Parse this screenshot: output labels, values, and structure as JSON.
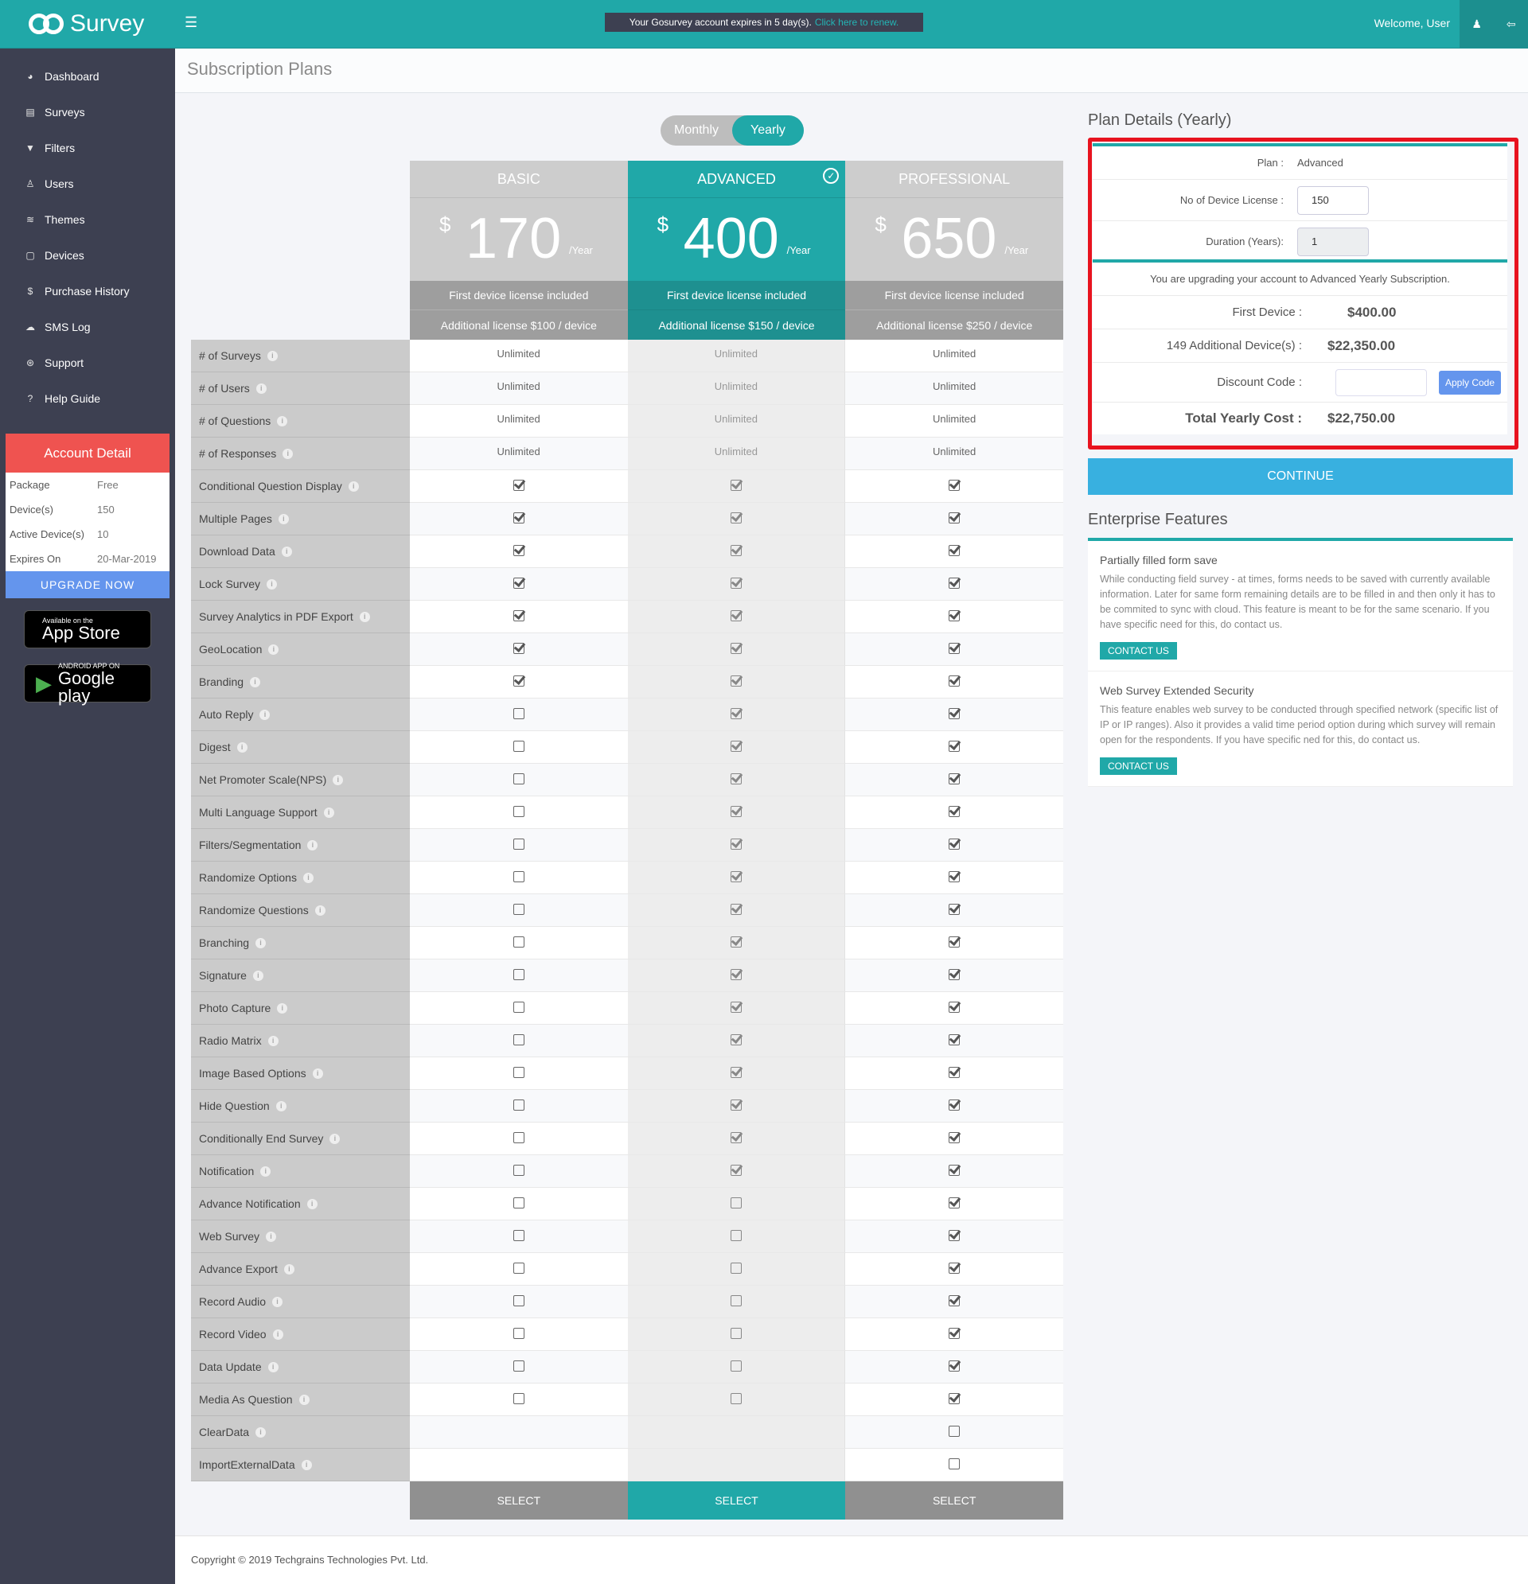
{
  "app": {
    "name": "Survey",
    "logo": "GO"
  },
  "header": {
    "notice_text": "Your Gosurvey account expires in 5 day(s).",
    "notice_link": "Click here to renew.",
    "welcome": "Welcome, User",
    "icons": [
      "menu-icon",
      "user-icon",
      "logout-icon"
    ]
  },
  "sidebar": {
    "items": [
      {
        "label": "Dashboard",
        "icon": "dashboard-icon",
        "glyph": "◕"
      },
      {
        "label": "Surveys",
        "icon": "surveys-icon",
        "glyph": "▤"
      },
      {
        "label": "Filters",
        "icon": "filter-icon",
        "glyph": "▼"
      },
      {
        "label": "Users",
        "icon": "user-icon",
        "glyph": "♙"
      },
      {
        "label": "Themes",
        "icon": "layers-icon",
        "glyph": "≋"
      },
      {
        "label": "Devices",
        "icon": "device-icon",
        "glyph": "▢"
      },
      {
        "label": "Purchase History",
        "icon": "dollar-icon",
        "glyph": "$"
      },
      {
        "label": "SMS Log",
        "icon": "chat-icon",
        "glyph": "☁"
      },
      {
        "label": "Support",
        "icon": "support-icon",
        "glyph": "⊛"
      },
      {
        "label": "Help Guide",
        "icon": "question-icon",
        "glyph": "?"
      }
    ],
    "account": {
      "title": "Account Detail",
      "rows": [
        {
          "k": "Package",
          "v": "Free"
        },
        {
          "k": "Device(s)",
          "v": "150"
        },
        {
          "k": "Active Device(s)",
          "v": "10"
        },
        {
          "k": "Expires On",
          "v": "20-Mar-2019"
        }
      ],
      "upgrade": "UPGRADE NOW"
    },
    "appstore": {
      "small": "Available on the",
      "big": "App Store"
    },
    "googleplay": {
      "small": "ANDROID APP ON",
      "big": "Google play"
    }
  },
  "page": {
    "title": "Subscription Plans"
  },
  "billing_toggle": {
    "options": [
      "Monthly",
      "Yearly"
    ],
    "selected": "Yearly"
  },
  "plans": [
    {
      "name": "BASIC",
      "currency": "$",
      "price": "170",
      "period": "/Year",
      "first": "First device license included",
      "additional": "Additional license $100 / device",
      "select": "SELECT",
      "selected": false
    },
    {
      "name": "ADVANCED",
      "currency": "$",
      "price": "400",
      "period": "/Year",
      "first": "First device license included",
      "additional": "Additional license $150 / device",
      "select": "SELECT",
      "selected": true
    },
    {
      "name": "PROFESSIONAL",
      "currency": "$",
      "price": "650",
      "period": "/Year",
      "first": "First device license included",
      "additional": "Additional license $250 / device",
      "select": "SELECT",
      "selected": false
    }
  ],
  "features": [
    {
      "label": "# of Surveys",
      "values": [
        "Unlimited",
        "Unlimited",
        "Unlimited"
      ]
    },
    {
      "label": "# of Users",
      "values": [
        "Unlimited",
        "Unlimited",
        "Unlimited"
      ]
    },
    {
      "label": "# of Questions",
      "values": [
        "Unlimited",
        "Unlimited",
        "Unlimited"
      ]
    },
    {
      "label": "# of Responses",
      "values": [
        "Unlimited",
        "Unlimited",
        "Unlimited"
      ]
    },
    {
      "label": "Conditional Question Display",
      "values": [
        true,
        true,
        true
      ]
    },
    {
      "label": "Multiple Pages",
      "values": [
        true,
        true,
        true
      ]
    },
    {
      "label": "Download Data",
      "values": [
        true,
        true,
        true
      ]
    },
    {
      "label": "Lock Survey",
      "values": [
        true,
        true,
        true
      ]
    },
    {
      "label": "Survey Analytics in PDF Export",
      "values": [
        true,
        true,
        true
      ]
    },
    {
      "label": "GeoLocation",
      "values": [
        true,
        true,
        true
      ]
    },
    {
      "label": "Branding",
      "values": [
        true,
        true,
        true
      ]
    },
    {
      "label": "Auto Reply",
      "values": [
        false,
        true,
        true
      ]
    },
    {
      "label": "Digest",
      "values": [
        false,
        true,
        true
      ]
    },
    {
      "label": "Net Promoter Scale(NPS)",
      "values": [
        false,
        true,
        true
      ]
    },
    {
      "label": "Multi Language Support",
      "values": [
        false,
        true,
        true
      ]
    },
    {
      "label": "Filters/Segmentation",
      "values": [
        false,
        true,
        true
      ]
    },
    {
      "label": "Randomize Options",
      "values": [
        false,
        true,
        true
      ]
    },
    {
      "label": "Randomize Questions",
      "values": [
        false,
        true,
        true
      ]
    },
    {
      "label": "Branching",
      "values": [
        false,
        true,
        true
      ]
    },
    {
      "label": "Signature",
      "values": [
        false,
        true,
        true
      ]
    },
    {
      "label": "Photo Capture",
      "values": [
        false,
        true,
        true
      ]
    },
    {
      "label": "Radio Matrix",
      "values": [
        false,
        true,
        true
      ]
    },
    {
      "label": "Image Based Options",
      "values": [
        false,
        true,
        true
      ]
    },
    {
      "label": "Hide Question",
      "values": [
        false,
        true,
        true
      ]
    },
    {
      "label": "Conditionally End Survey",
      "values": [
        false,
        true,
        true
      ]
    },
    {
      "label": "Notification",
      "values": [
        false,
        true,
        true
      ]
    },
    {
      "label": "Advance Notification",
      "values": [
        false,
        false,
        true
      ]
    },
    {
      "label": "Web Survey",
      "values": [
        false,
        false,
        true
      ]
    },
    {
      "label": "Advance Export",
      "values": [
        false,
        false,
        true
      ]
    },
    {
      "label": "Record Audio",
      "values": [
        false,
        false,
        true
      ]
    },
    {
      "label": "Record Video",
      "values": [
        false,
        false,
        true
      ]
    },
    {
      "label": "Data Update",
      "values": [
        false,
        false,
        true
      ]
    },
    {
      "label": "Media As Question",
      "values": [
        false,
        false,
        true
      ]
    },
    {
      "label": "ClearData",
      "values": [
        null,
        null,
        false
      ]
    },
    {
      "label": "ImportExternalData",
      "values": [
        null,
        null,
        false
      ]
    }
  ],
  "plan_details": {
    "title": "Plan Details (Yearly)",
    "plan_label": "Plan :",
    "plan_value": "Advanced",
    "devices_label": "No of Device License :",
    "devices_value": "150",
    "duration_label": "Duration (Years):",
    "duration_value": "1",
    "upgrade_msg": "You are upgrading your account to Advanced Yearly Subscription.",
    "first_device_label": "First Device :",
    "first_device_value": "$400.00",
    "additional_label": "149 Additional Device(s) :",
    "additional_value": "$22,350.00",
    "discount_label": "Discount Code :",
    "discount_value": "",
    "apply_label": "Apply Code",
    "total_label": "Total Yearly Cost :",
    "total_value": "$22,750.00",
    "continue_label": "CONTINUE"
  },
  "enterprise": {
    "title": "Enterprise Features",
    "items": [
      {
        "title": "Partially filled form save",
        "text": "While conducting field survey - at times, forms needs to be saved with currently available information. Later for same form remaining details are to be filled in and then only it has to be commited to sync with cloud. This feature is meant to be for the same scenario. If you have specific need for this, do contact us.",
        "button": "CONTACT US"
      },
      {
        "title": "Web Survey Extended Security",
        "text": "This feature enables web survey to be conducted through specified network (specific list of IP or IP ranges). Also it provides a valid time period option during which survey will remain open for the respondents. If you have specific ned for this, do contact us.",
        "button": "CONTACT US"
      }
    ]
  },
  "footer": {
    "copyright": "Copyright © 2019 Techgrains Technologies Pvt. Ltd."
  },
  "colors": {
    "brand": "#20a8a8",
    "sidebar": "#3d4051",
    "account_header": "#ef5350",
    "upgrade": "#6495ed",
    "continue": "#38b0e0",
    "highlight_border": "#e8131f"
  }
}
